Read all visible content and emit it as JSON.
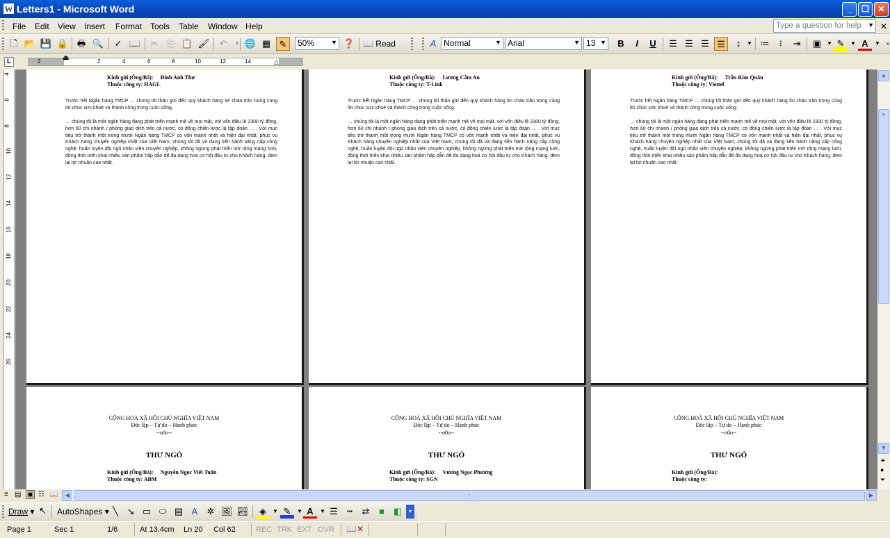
{
  "window": {
    "title": "Letters1 - Microsoft Word"
  },
  "menu": [
    "File",
    "Edit",
    "View",
    "Insert",
    "Format",
    "Tools",
    "Table",
    "Window",
    "Help"
  ],
  "help_box": {
    "placeholder": "Type a question for help"
  },
  "toolbar": {
    "zoom": "50%",
    "read_label": "Read",
    "style": "Normal",
    "font": "Arial",
    "size": "13"
  },
  "hruler_numbers": [
    "2",
    "2",
    "4",
    "6",
    "8",
    "10",
    "12",
    "14"
  ],
  "vruler_numbers": [
    "4",
    "6",
    "8",
    "10",
    "12",
    "14",
    "16",
    "18",
    "20",
    "22",
    "24",
    "26"
  ],
  "letter": {
    "to_label": "Kính gửi (Ông/Bà):",
    "company_label": "Thuộc công ty:",
    "intro": "Trước hết Ngân hàng TMCP … chúng tôi thân gửi đến quý khách hàng lời chào trân trọng cùng lời chúc sức khoẻ và thành công trong cuộc sống.",
    "body": "… chúng tôi là một ngân hàng đang phát triển mạnh mẽ về mọi mặt, với vốn điều lệ 2300 tỷ đồng, hơn 60 chi nhánh / phòng giao dịch trên cả nước, có đồng chiến lược là tập đoàn … . Với mục tiêu trở thành một trong mười Ngân hàng TMCP có vốn mạnh nhất và hiện đại nhất, phục vụ Khách hàng chuyên nghiệp nhất của Việt Nam, chúng tôi đã và đang tiến hành nâng cấp công nghệ, huấn luyện đội ngũ nhân viên chuyên nghiệp, không ngừng phát triển mở rộng mạng lưới, đồng thời triển khai nhiều sản phẩm hấp dẫn để đa dạng hoá cơ hội đầu tư cho Khách hàng, đem lại lợi nhuận cao nhất.",
    "header1": "CỘNG HOÀ XÃ HỘI CHỦ NGHĨA VIỆT NAM",
    "header2": "Độc lập – Tự do – Hạnh phúc",
    "header3": "--o0o--",
    "title": "THƯ NGỎ"
  },
  "top_pages": [
    {
      "name": "Đinh Anh Thư",
      "company": "HAGL"
    },
    {
      "name": "Lương Cẩm An",
      "company": "T-Link"
    },
    {
      "name": "Trần Kim Quân",
      "company": "Viettel"
    }
  ],
  "bottom_pages": [
    {
      "name": "Nguyễn Ngọc Viết Tuấn",
      "company": "ABM"
    },
    {
      "name": "Vương Ngọc Phương",
      "company": "SGN"
    },
    {
      "name": "",
      "company": ""
    }
  ],
  "drawbar": {
    "draw_label": "Draw",
    "autoshapes_label": "AutoShapes"
  },
  "status": {
    "page": "Page 1",
    "sec": "Sec 1",
    "pages": "1/6",
    "at": "At 13.4cm",
    "ln": "Ln 20",
    "col": "Col 62",
    "rec": "REC",
    "trk": "TRK",
    "ext": "EXT",
    "ovr": "OVR"
  }
}
